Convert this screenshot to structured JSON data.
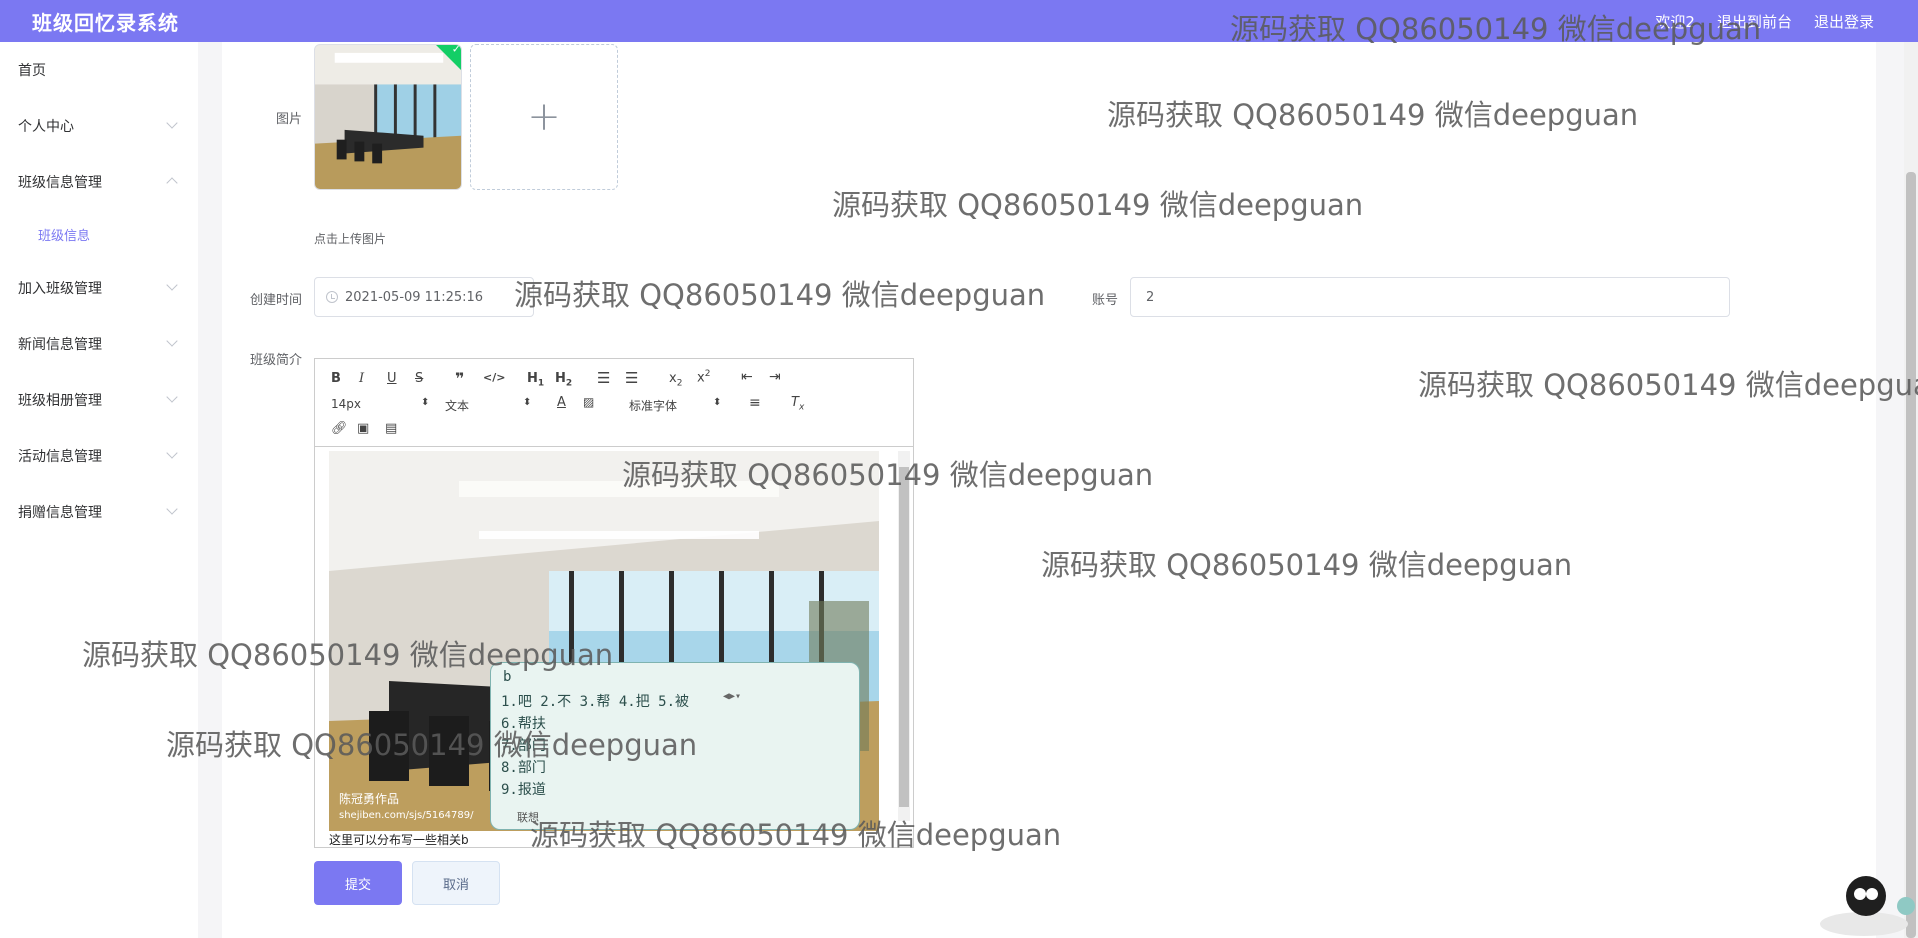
{
  "header": {
    "title": "班级回忆录系统",
    "links": [
      "欢迎2",
      "退出到前台",
      "退出登录"
    ]
  },
  "sidebar": {
    "items": [
      {
        "label": "首页"
      },
      {
        "label": "个人中心"
      },
      {
        "label": "班级信息管理"
      },
      {
        "label": "加入班级管理"
      },
      {
        "label": "新闻信息管理"
      },
      {
        "label": "班级相册管理"
      },
      {
        "label": "活动信息管理"
      },
      {
        "label": "捐赠信息管理"
      }
    ],
    "sub_item": "班级信息"
  },
  "form": {
    "image_label": "图片",
    "upload_tip": "点击上传图片",
    "upload_plus": "+",
    "created_label": "创建时间",
    "created_value": "2021-05-09 11:25:16",
    "account_label": "账号",
    "account_value": "2",
    "intro_label": "班级简介",
    "editor_text": "这里可以分布写一些相关b",
    "submit": "提交",
    "cancel": "取消"
  },
  "editor_toolbar": {
    "font_size": "14px",
    "text_style": "文本",
    "font_family": "标准字体"
  },
  "photo_caption": {
    "line1": "陈冠勇作品",
    "line2": "shejiben.com/sjs/5164789/"
  },
  "ime": {
    "input": "b",
    "first_row": "1.吧 2.不 3.帮 4.把 5.被",
    "candidates": [
      "6.帮扶",
      "7.部门",
      "8.部门",
      "9.报道"
    ],
    "footer": "联想"
  },
  "watermark": "源码获取 QQ86050149 微信deepguan",
  "colors": {
    "accent": "#7b78f2",
    "success": "#13ce66"
  }
}
